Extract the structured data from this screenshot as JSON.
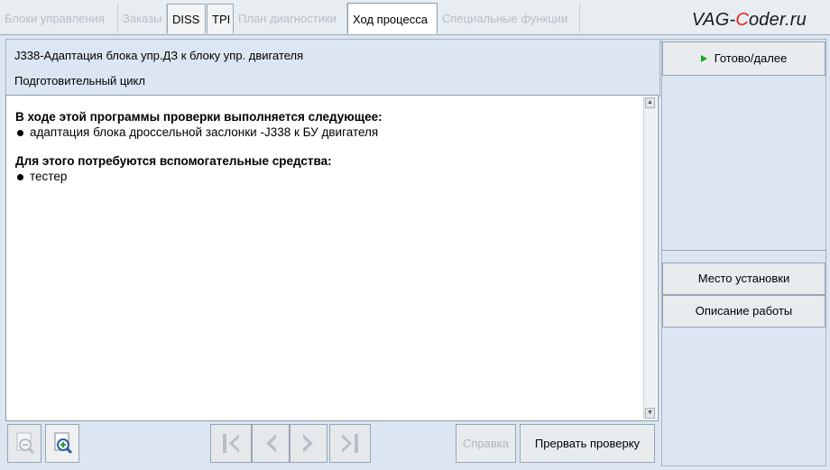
{
  "tabs": [
    {
      "label": "Блоки управления",
      "state": "disabled"
    },
    {
      "label": "Заказы",
      "state": "disabled"
    },
    {
      "label": "DISS",
      "state": "enabled"
    },
    {
      "label": "TPI",
      "state": "enabled"
    },
    {
      "label": "План диагностики",
      "state": "disabled"
    },
    {
      "label": "Ход процесса",
      "state": "selected"
    },
    {
      "label": "Специальные функции",
      "state": "disabled"
    }
  ],
  "logo": {
    "prefix": "VAG-",
    "highlight": "C",
    "suffix": "oder.ru"
  },
  "header": {
    "title": "J338-Адаптация блока упр.ДЗ к блоку упр. двигателя",
    "subtitle": "Подготовительный цикл"
  },
  "content": {
    "heading1": "В ходе этой программы проверки выполняется следующее:",
    "item1": "адаптация блока дроссельной заслонки -J338 к БУ двигателя",
    "heading2": "Для этого потребуются вспомогательные средства:",
    "item2": "тестер"
  },
  "toolbar": {
    "zoom_out_icon": "zoom-out-icon",
    "zoom_in_icon": "zoom-in-icon",
    "nav_icons": [
      "first-page-icon",
      "previous-icon",
      "next-icon",
      "last-page-icon"
    ],
    "help_label": "Справка",
    "abort_label": "Прервать проверку"
  },
  "right_panel": {
    "ready_label": "Готово/далее",
    "location_label": "Место установки",
    "description_label": "Описание работы"
  },
  "colors": {
    "panel_bg": "#dbe6f2",
    "play_arrow": "#1ea51e",
    "logo_accent": "#e3201b"
  }
}
